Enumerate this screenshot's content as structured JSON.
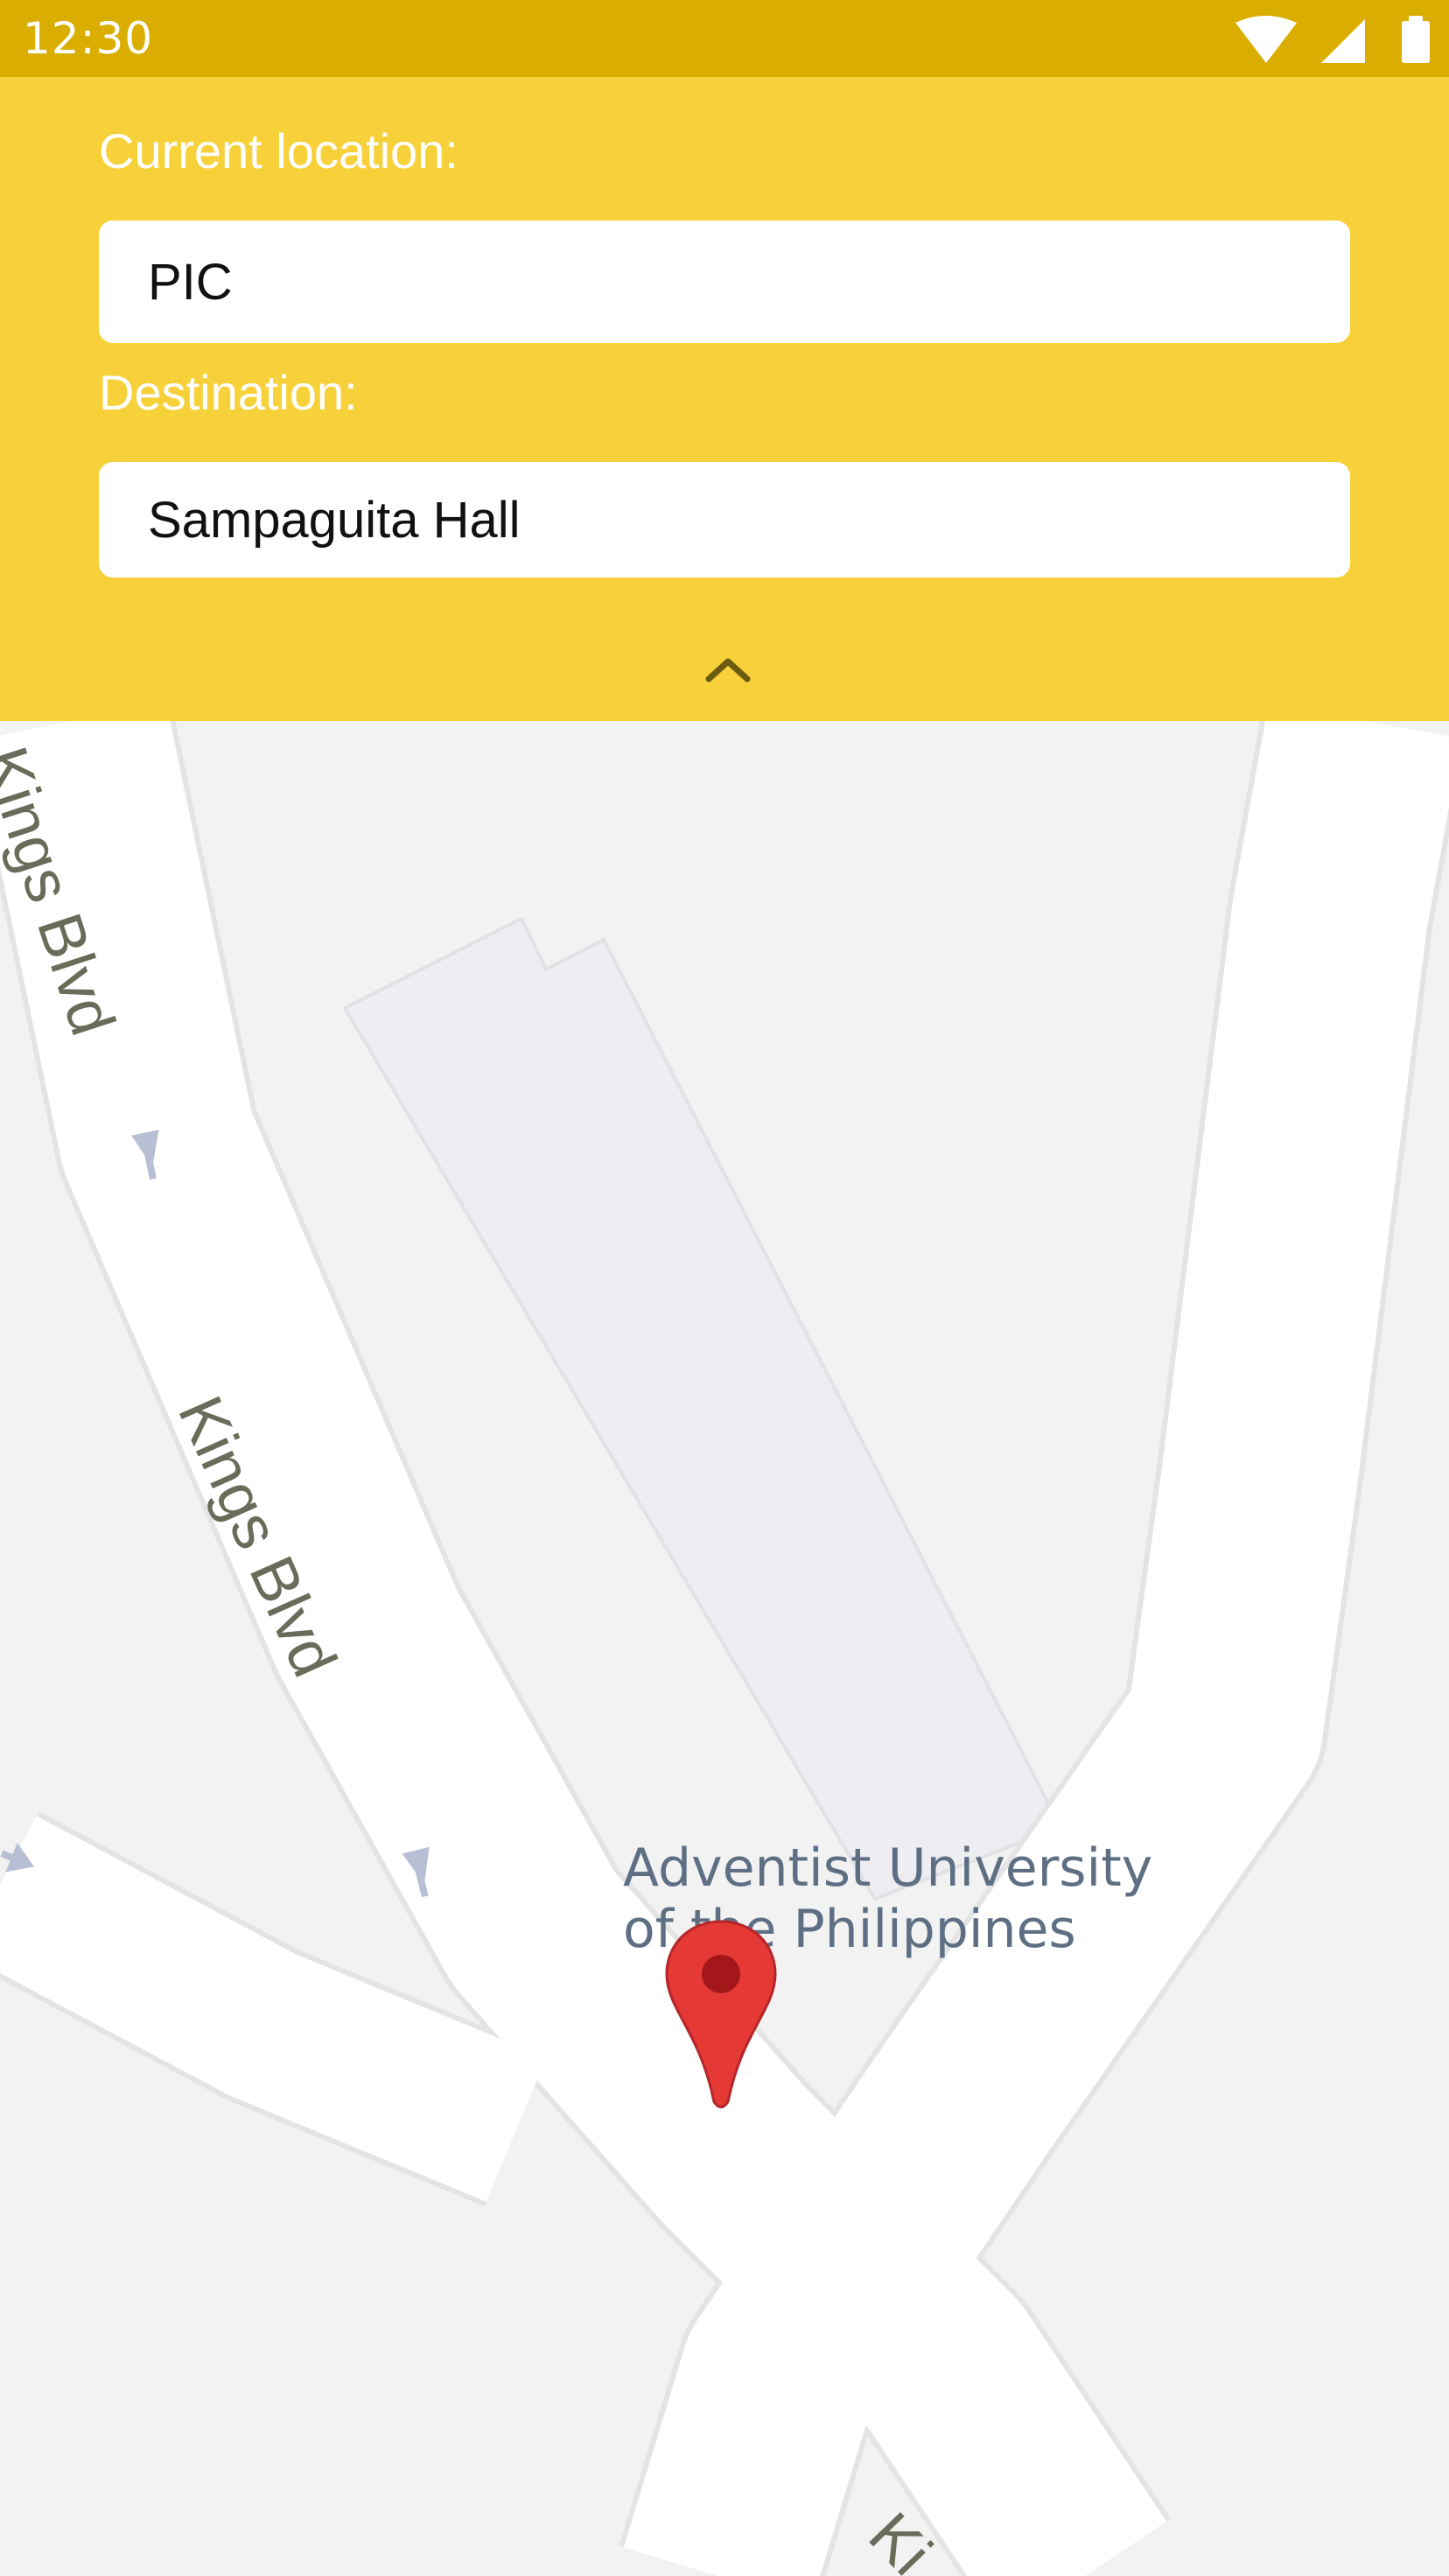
{
  "status_bar": {
    "time": "12:30",
    "icons": [
      "wifi-icon",
      "cellular-signal-icon",
      "battery-icon"
    ]
  },
  "route_form": {
    "current_location_label": "Current location:",
    "current_location_value": "PIC",
    "destination_label": "Destination:",
    "destination_value": "Sampaguita Hall",
    "collapse_icon": "chevron-up-icon"
  },
  "map": {
    "street_labels": [
      "Kings Blvd",
      "Kings Blvd",
      "Ki"
    ],
    "place_label_line1": "Adventist University",
    "place_label_line2": "of the Philippines",
    "marker_icon": "map-pin-icon"
  },
  "colors": {
    "status_bar": "#d9ae00",
    "panel": "#f7d13a",
    "map_background": "#f2f2f2",
    "road": "#ffffff",
    "marker": "#e53935"
  }
}
